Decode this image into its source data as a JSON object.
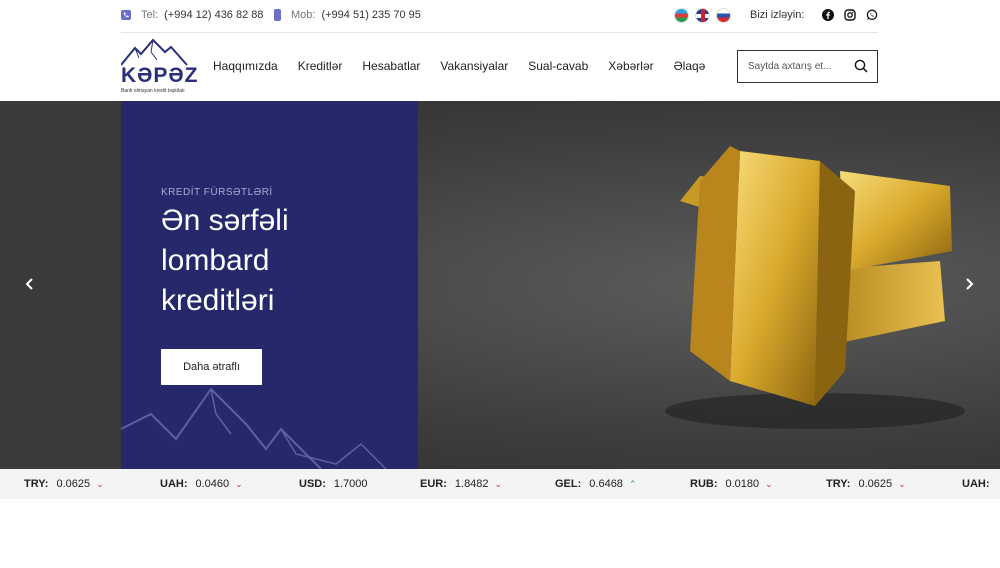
{
  "topbar": {
    "tel_label": "Tel:",
    "tel_value": "(+994 12) 436 82 88",
    "mob_label": "Mob:",
    "mob_value": "(+994 51) 235 70 95",
    "follow_label": "Bizi izləyin:",
    "languages": [
      "az",
      "en",
      "ru"
    ],
    "social": [
      "facebook-icon",
      "instagram-icon",
      "whatsapp-icon"
    ]
  },
  "header": {
    "logo_word": "KƏPƏZ",
    "logo_tagline": "Bank olmayan kredit təşkilatı",
    "nav": [
      "Haqqımızda",
      "Kreditlər",
      "Hesabatlar",
      "Vakansiyalar",
      "Sual-cavab",
      "Xəbərlər",
      "Əlaqə"
    ],
    "search_placeholder": "Saytda axtarış et..."
  },
  "hero": {
    "eyebrow": "KREDİT FÜRSƏTLƏRİ",
    "headline": "Ən sərfəli lombard kreditləri",
    "cta": "Daha ətraflı",
    "panel_color": "#25296b"
  },
  "rates": [
    {
      "code": "TRY:",
      "value": "0.0625",
      "trend": "down"
    },
    {
      "code": "UAH:",
      "value": "0.0460",
      "trend": "down"
    },
    {
      "code": "USD:",
      "value": "1.7000",
      "trend": "none"
    },
    {
      "code": "EUR:",
      "value": "1.8482",
      "trend": "down"
    },
    {
      "code": "GEL:",
      "value": "0.6468",
      "trend": "up"
    },
    {
      "code": "RUB:",
      "value": "0.0180",
      "trend": "down"
    },
    {
      "code": "TRY:",
      "value": "0.0625",
      "trend": "down"
    },
    {
      "code": "UAH:",
      "value": "",
      "trend": "none"
    }
  ]
}
